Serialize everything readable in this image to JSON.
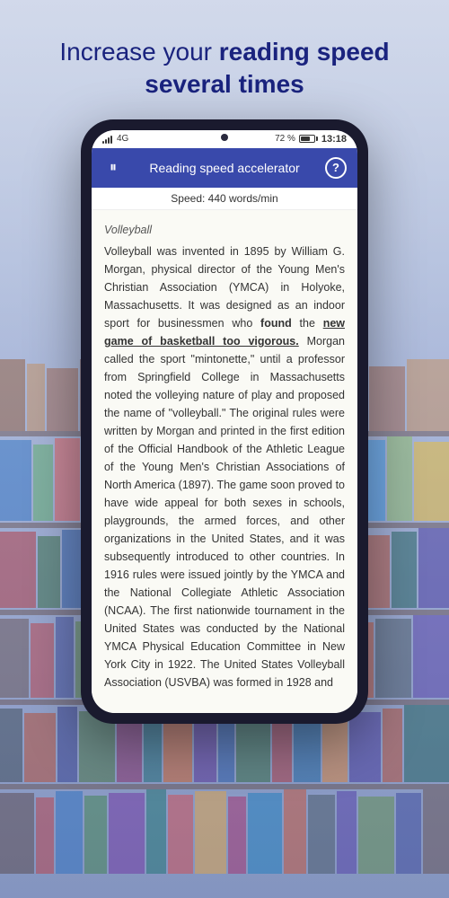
{
  "header": {
    "line1": "Increase your ",
    "line1_bold": "reading speed",
    "line2_bold": "several times"
  },
  "status_bar": {
    "signal": "4G",
    "battery_percent": "72 %",
    "time": "13:18"
  },
  "app_bar": {
    "title": "Reading speed accelerator",
    "pause_icon": "⏸",
    "help_icon": "?"
  },
  "speed_bar": {
    "label": "Speed: 440 words/min"
  },
  "content": {
    "title": "Volleyball",
    "body": "Volleyball was invented in 1895 by William G. Morgan, physical director of the Young Men's Christian Association (YMCA) in Holyoke, Massachusetts. It was designed as an indoor sport for businessmen who found the new game of basketball too vigorous. Morgan called the sport \"mintonette,\" until a professor from Springfield College in Massachusetts noted the volleying nature of play and proposed the name of \"volleyball.\" The original rules were written by Morgan and printed in the first edition of the Official Handbook of the Athletic League of the Young Men's Christian Associations of North America (1897). The game soon proved to have wide appeal for both sexes in schools, playgrounds, the armed forces, and other organizations in the United States, and it was subsequently introduced to other countries. In 1916 rules were issued jointly by the YMCA and the National Collegiate Athletic Association (NCAA). The first nationwide tournament in the United States was conducted by the National YMCA Physical Education Committee in New York City in 1922. The United States Volleyball Association (USVBA) was formed in 1928 and"
  }
}
